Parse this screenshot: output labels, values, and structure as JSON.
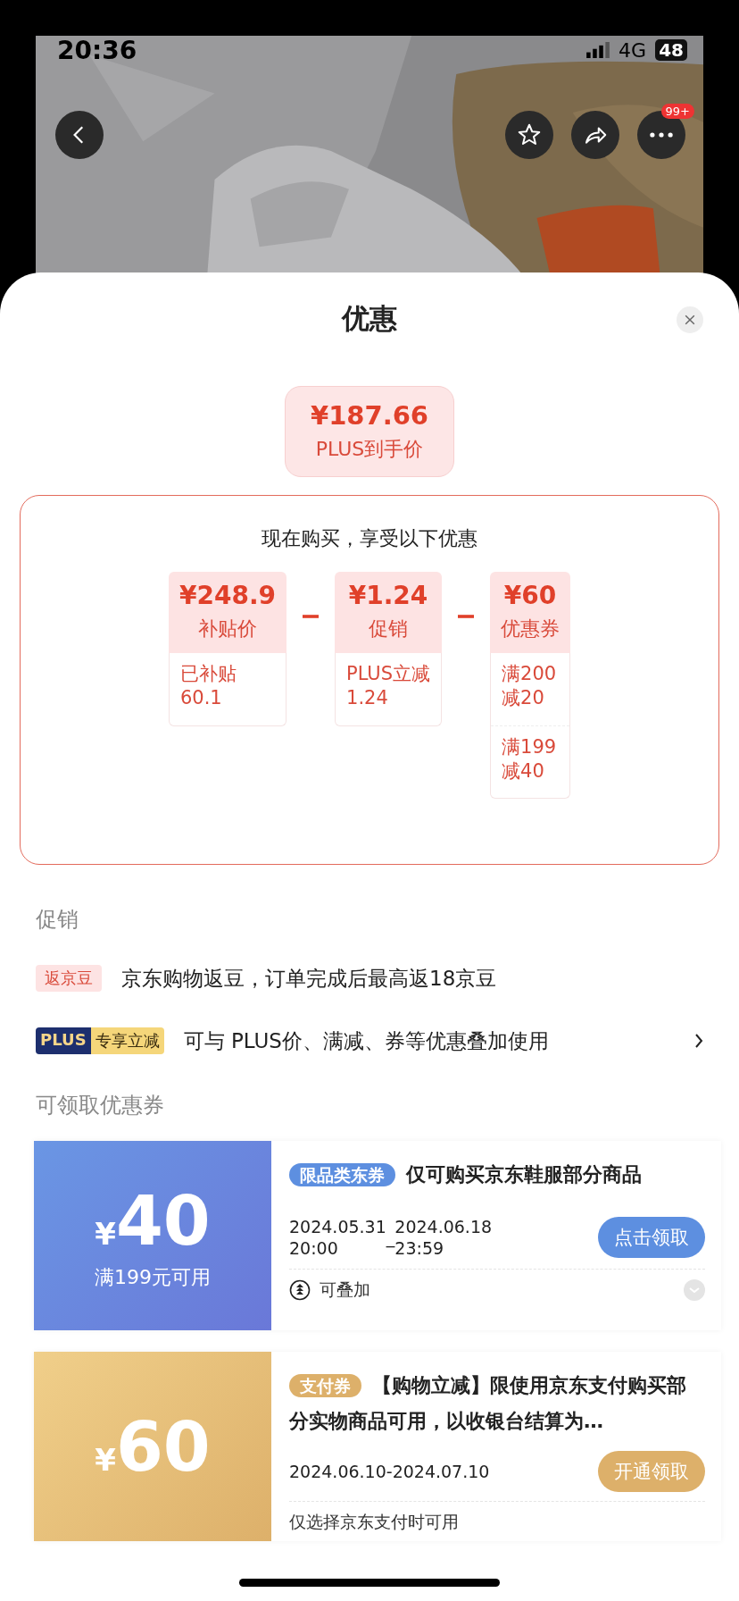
{
  "status_bar": {
    "time": "20:36",
    "network": "4G",
    "battery": "48"
  },
  "header": {
    "more_badge": "99+"
  },
  "sheet": {
    "title": "优惠",
    "final_price": {
      "amount": "¥187.66",
      "label": "PLUS到手价"
    },
    "breakdown": {
      "title": "现在购买，享受以下优惠",
      "items": [
        {
          "amount": "¥248.9",
          "label": "补贴价",
          "details": [
            "已补贴\n60.1"
          ]
        },
        {
          "amount": "¥1.24",
          "label": "促销",
          "details": [
            "PLUS立减\n1.24"
          ]
        },
        {
          "amount": "¥60",
          "label": "优惠券",
          "details": [
            "满200\n减20",
            "满199\n减40"
          ]
        }
      ]
    },
    "promotions": {
      "heading": "促销",
      "rows": [
        {
          "kind": "tag",
          "tag": "返京豆",
          "text": "京东购物返豆，订单完成后最高返18京豆",
          "has_chevron": false
        },
        {
          "kind": "plus",
          "badge": "PLUS",
          "tag": "专享立减",
          "text": "可与 PLUS价、满减、券等优惠叠加使用",
          "has_chevron": true
        }
      ]
    },
    "coupons": {
      "heading": "可领取优惠券",
      "items": [
        {
          "kind": "category",
          "currency": "¥",
          "amount": "40",
          "condition": "满199元可用",
          "tag": "限品类东券",
          "title": "仅可购买京东鞋服部分商品",
          "start_date": "2024.05.31",
          "start_time": "20:00",
          "separator": "_",
          "end_date": "2024.06.18",
          "end_time": "23:59",
          "button": "点击领取",
          "note": "可叠加",
          "note_icon": true,
          "expandable": true
        },
        {
          "kind": "payment",
          "currency": "¥",
          "amount": "60",
          "tag": "支付券",
          "title": "【购物立减】限使用京东支付购买部分实物商品可用，以收银台结算为…",
          "validity": "2024.06.10-2024.07.10",
          "button": "开通领取",
          "note": "仅选择京东支付时可用",
          "note_icon": false,
          "expandable": false
        }
      ]
    }
  }
}
